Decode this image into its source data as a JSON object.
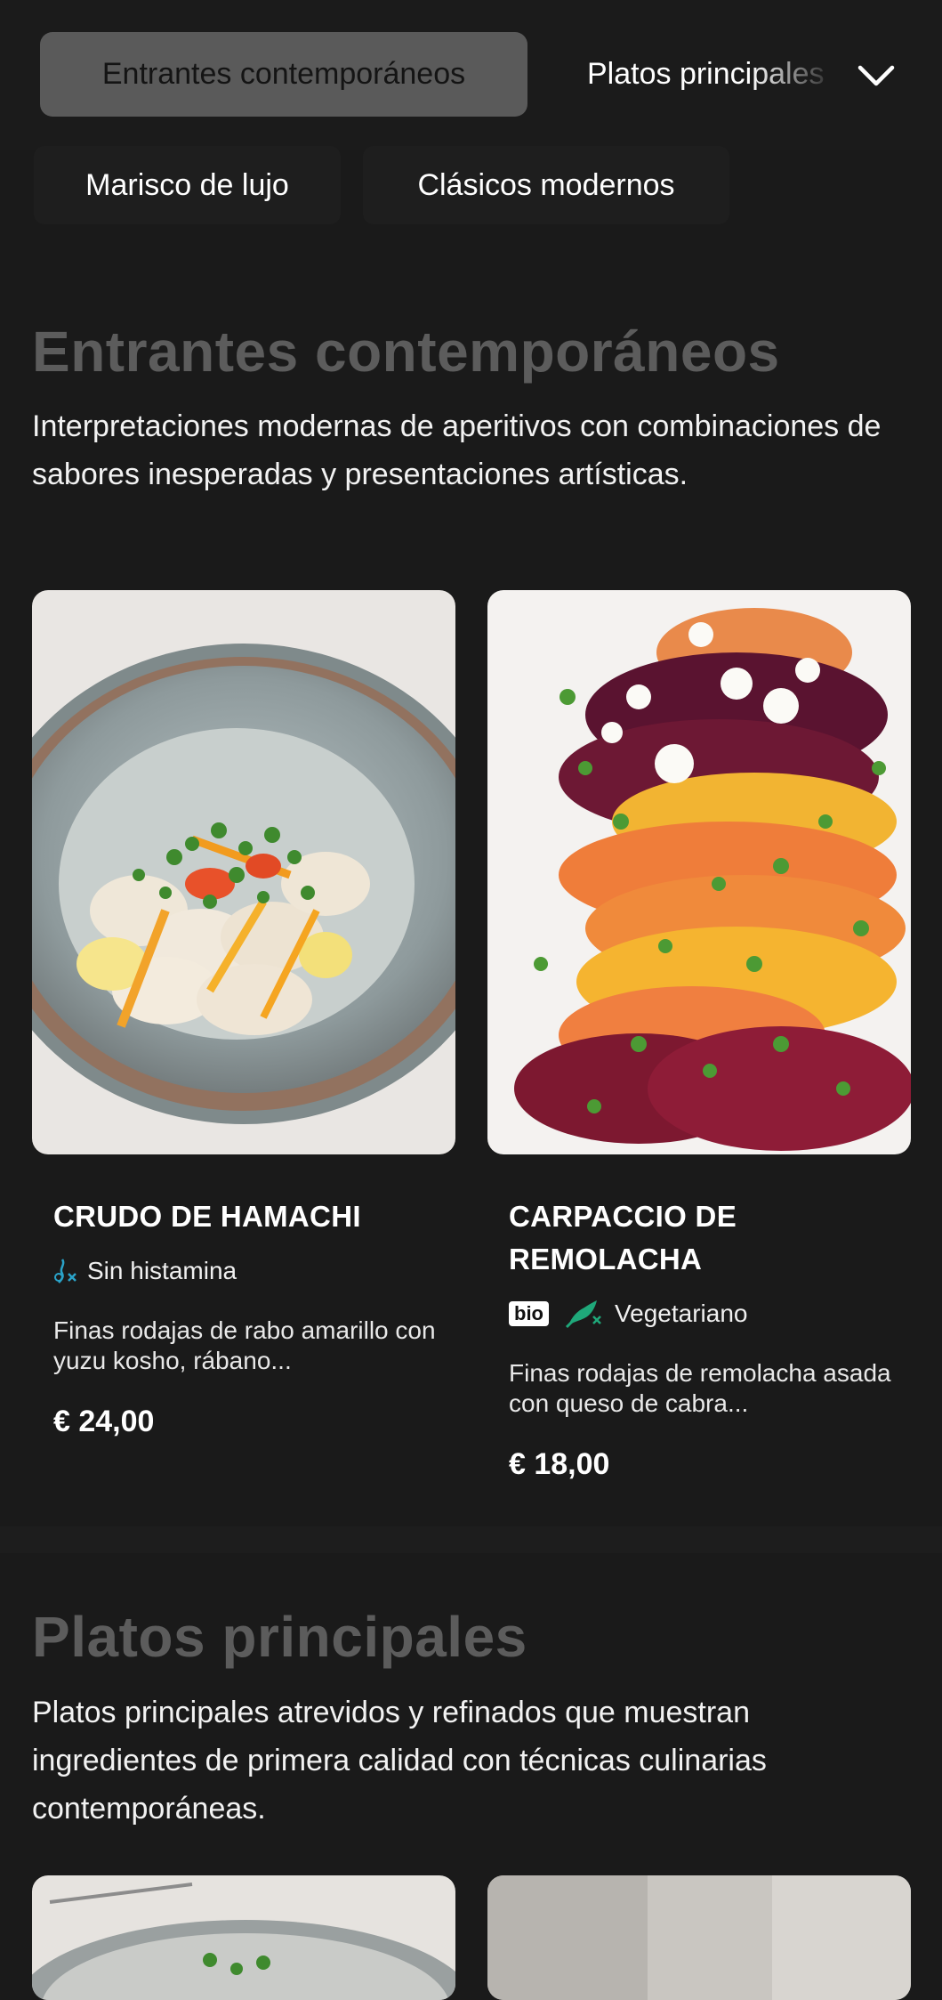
{
  "nav": {
    "active_chip": "Entrantes contemporáneos",
    "next_chip": "Platos principales",
    "chips_row2": [
      "Marisco de lujo",
      "Clásicos modernos"
    ],
    "expand_icon": "chevron-down-icon"
  },
  "sections": [
    {
      "title": "Entrantes contemporáneos",
      "description": "Interpretaciones modernas de aperitivos con combinaciones de sabores inesperadas y presentaciones artísticas.",
      "items": [
        {
          "name": "CRUDO DE HAMACHI",
          "tags": [
            {
              "icon": "no-histamine-icon",
              "label": "Sin histamina",
              "color": "#2aa3c9"
            }
          ],
          "description": "Finas rodajas de rabo amarillo con yuzu kosho, rábano...",
          "price": "€ 24,00"
        },
        {
          "name": "CARPACCIO DE REMOLACHA",
          "badge": "bio",
          "tags": [
            {
              "icon": "vegetarian-icon",
              "label": "Vegetariano",
              "color": "#1fa87a"
            }
          ],
          "description": "Finas rodajas de remolacha asada con queso de cabra...",
          "price": "€ 18,00"
        }
      ]
    },
    {
      "title": "Platos principales",
      "description": "Platos principales atrevidos y refinados que muestran ingredientes de primera calidad con técnicas culinarias contemporáneas."
    }
  ]
}
